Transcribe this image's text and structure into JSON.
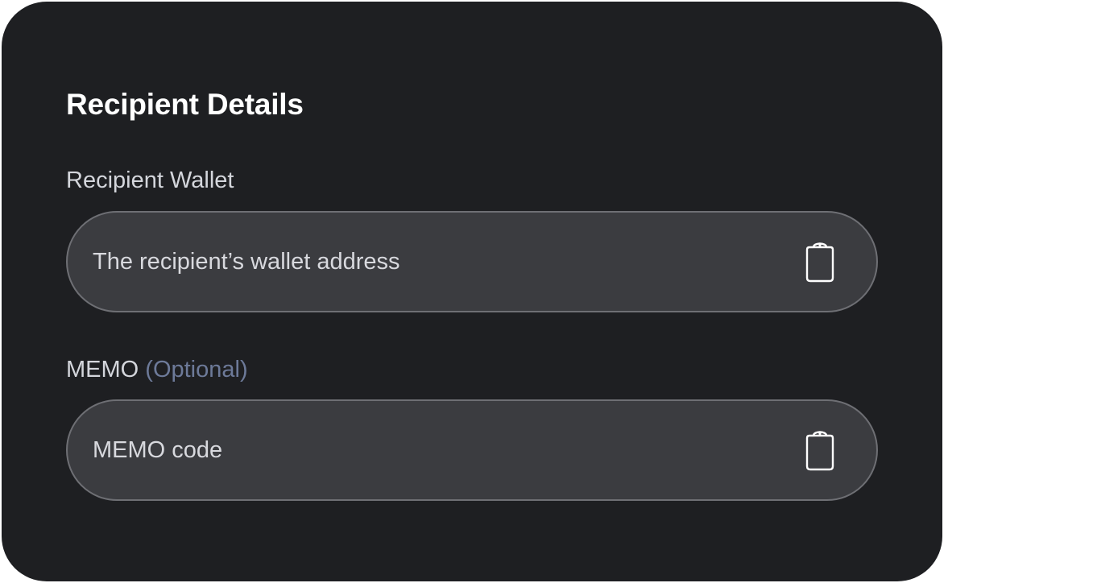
{
  "card": {
    "title": "Recipient Details"
  },
  "wallet": {
    "label": "Recipient Wallet",
    "placeholder": "The recipient’s wallet address",
    "value": "",
    "paste_icon": "clipboard-icon"
  },
  "memo": {
    "label": "MEMO",
    "optional_label": "(Optional)",
    "placeholder": "MEMO code",
    "value": "",
    "paste_icon": "clipboard-icon"
  },
  "colors": {
    "card_background": "#1e1f22",
    "field_background": "#3b3c40",
    "field_border": "#6e6f74",
    "optional_text": "#6d7a99"
  }
}
